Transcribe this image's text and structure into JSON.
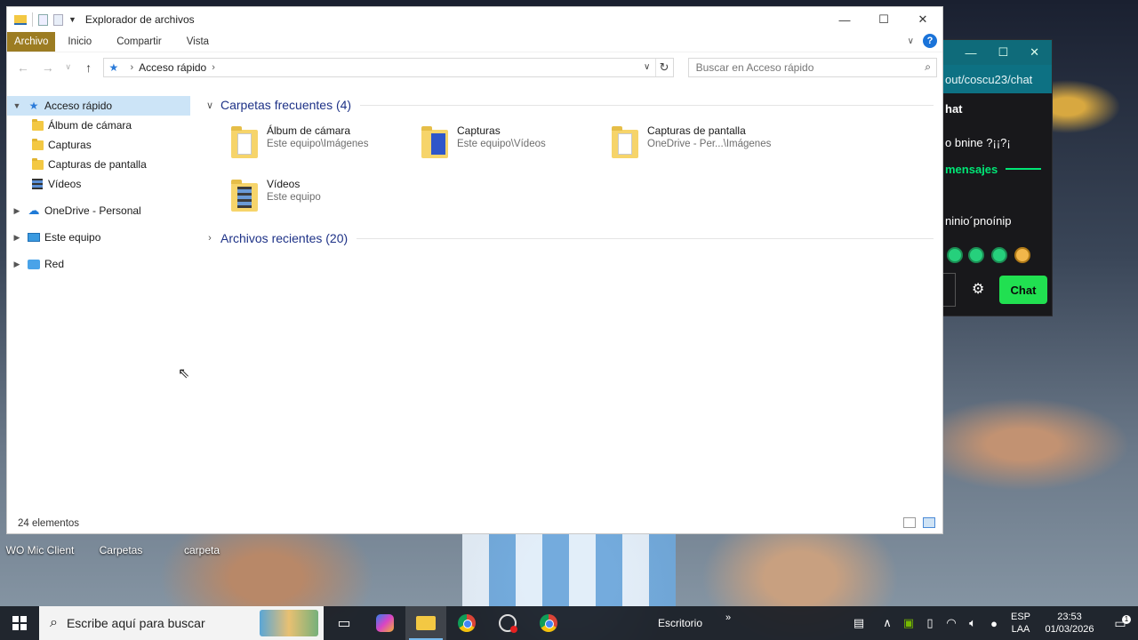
{
  "desktop": {
    "icons": [
      {
        "label": "WO Mic Client"
      },
      {
        "label": "Carpetas"
      },
      {
        "label": "carpeta"
      }
    ]
  },
  "chat": {
    "url": "out/coscu23/chat",
    "heading": "hat",
    "line1": "o bnine ?¡¡?¡",
    "line2": "mensajes",
    "line3": "ninio´pnoínip",
    "chat_button": "Chat"
  },
  "explorer": {
    "title": "Explorador de archivos",
    "tabs": [
      "Archivo",
      "Inicio",
      "Compartir",
      "Vista"
    ],
    "address": "Acceso rápido",
    "search_placeholder": "Buscar en Acceso rápido",
    "nav": {
      "quick_access": "Acceso rápido",
      "quick_items": [
        "Álbum de cámara",
        "Capturas",
        "Capturas de pantalla",
        "Vídeos"
      ],
      "onedrive": "OneDrive - Personal",
      "this_pc": "Este equipo",
      "network": "Red"
    },
    "frequent": {
      "header": "Carpetas frecuentes (4)",
      "items": [
        {
          "name": "Álbum de cámara",
          "path": "Este equipo\\Imágenes"
        },
        {
          "name": "Capturas",
          "path": "Este equipo\\Vídeos"
        },
        {
          "name": "Capturas de pantalla",
          "path": "OneDrive - Per...\\Imágenes"
        },
        {
          "name": "Vídeos",
          "path": "Este equipo"
        }
      ]
    },
    "recent": {
      "header": "Archivos recientes (20)"
    },
    "status": "24 elementos"
  },
  "taskbar": {
    "search_placeholder": "Escribe aquí para buscar",
    "desktop_label": "Escritorio",
    "lang_top": "ESP",
    "lang_bottom": "LAA",
    "time": "23:53",
    "date": "01/03/2026",
    "notification_count": "1"
  }
}
